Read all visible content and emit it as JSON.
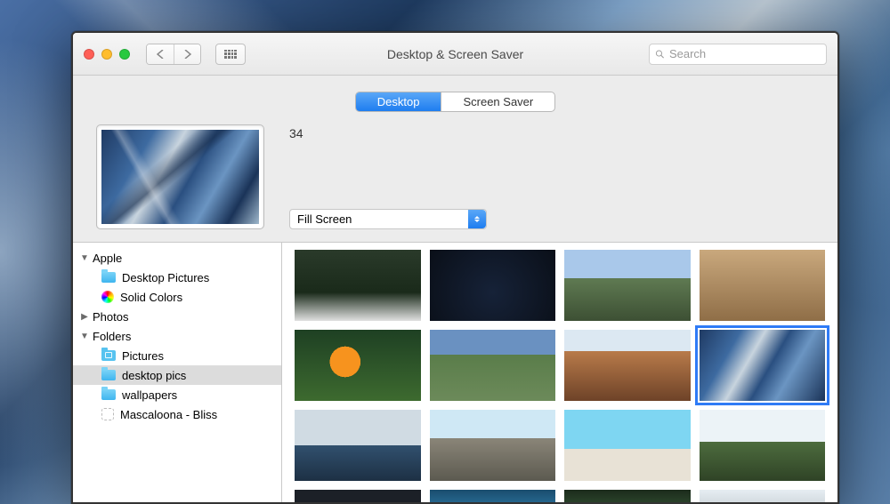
{
  "window": {
    "title": "Desktop & Screen Saver"
  },
  "search": {
    "placeholder": "Search"
  },
  "tabs": {
    "desktop": "Desktop",
    "screensaver": "Screen Saver",
    "active": "desktop"
  },
  "wallpaper": {
    "name": "34",
    "fit_mode": "Fill Screen"
  },
  "sidebar": {
    "apple": {
      "label": "Apple",
      "expanded": true,
      "items": {
        "desktop_pictures": "Desktop Pictures",
        "solid_colors": "Solid Colors"
      }
    },
    "photos": {
      "label": "Photos",
      "expanded": false
    },
    "folders": {
      "label": "Folders",
      "expanded": true,
      "items": {
        "pictures": "Pictures",
        "desktop_pics": "desktop pics",
        "wallpapers": "wallpapers",
        "mascaloona": "Mascaloona - Bliss"
      },
      "selected": "desktop_pics"
    }
  },
  "thumbnails": {
    "selected_index": 7,
    "count_visible": 16
  }
}
